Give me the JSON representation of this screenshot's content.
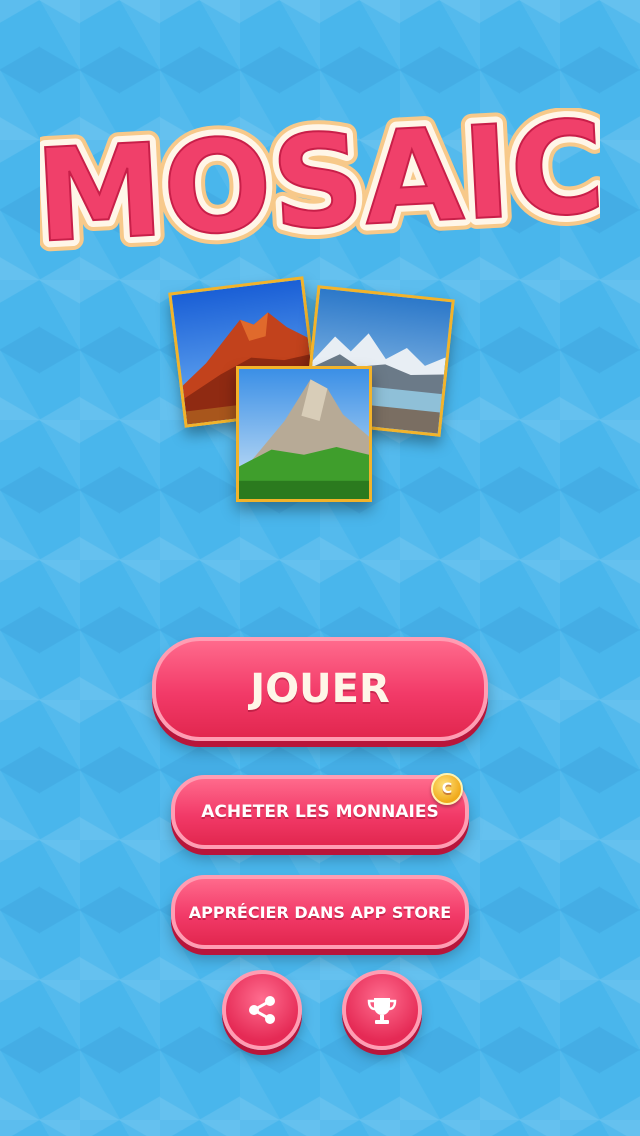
{
  "app": {
    "logo_text": "MOSAIC"
  },
  "menu": {
    "play_label": "JOUER",
    "buy_coins_label": "ACHETER LES MONNAIES",
    "coin_badge": "C",
    "rate_label": "APPRÉCIER DANS APP STORE"
  },
  "icons": {
    "share": "share-icon",
    "trophy": "trophy-icon",
    "coin": "coin-icon"
  },
  "colors": {
    "background": "#49b6ec",
    "button": "#f23a68",
    "logo": "#f0406a",
    "photo_frame": "#f3b32a"
  }
}
